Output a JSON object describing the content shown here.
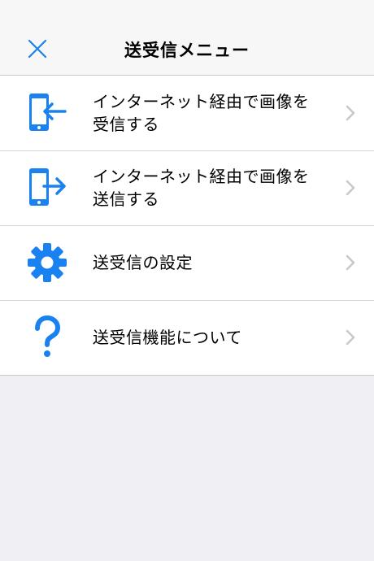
{
  "header": {
    "title": "送受信メニュー",
    "close_icon": "close-icon"
  },
  "menu": {
    "items": [
      {
        "label": "インターネット経由で画像を\n受信する",
        "icon": "phone-receive-icon"
      },
      {
        "label": "インターネット経由で画像を\n送信する",
        "icon": "phone-send-icon"
      },
      {
        "label": "送受信の設定",
        "icon": "gear-icon"
      },
      {
        "label": "送受信機能について",
        "icon": "question-mark-icon"
      }
    ]
  },
  "colors": {
    "accent": "#1a82f0",
    "background": "#efeff4",
    "header_bg": "#f7f7f7",
    "chevron": "#c7c7cc"
  }
}
